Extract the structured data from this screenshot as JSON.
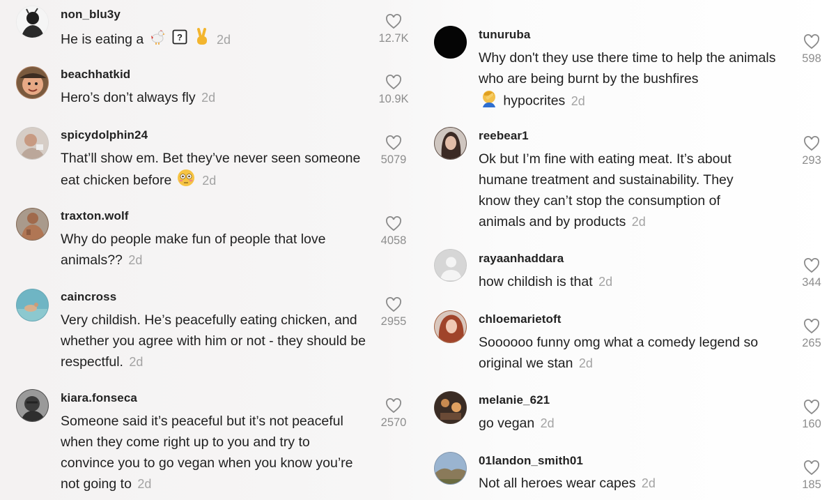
{
  "left_comments": [
    {
      "username": "non_blu3y",
      "text": "He is eating a",
      "date": "2d",
      "likes": "12.7K",
      "emoji": [
        "rooster",
        "unknown-box",
        "victory-hand"
      ]
    },
    {
      "username": "beachhatkid",
      "text": "Hero’s don’t always fly",
      "date": "2d",
      "likes": "10.9K"
    },
    {
      "username": "spicydolphin24",
      "text": "That’ll show em. Bet they’ve never seen someone eat chicken before",
      "date": "2d",
      "likes": "5079",
      "emoji": [
        "flushed-face"
      ]
    },
    {
      "username": "traxton.wolf",
      "text": "Why do people make fun of people that love animals??",
      "date": "2d",
      "likes": "4058"
    },
    {
      "username": "caincross",
      "text": "Very childish. He’s peacefully eating chicken, and whether you agree with him or not - they should be respectful.",
      "date": "2d",
      "likes": "2955"
    },
    {
      "username": "kiara.fonseca",
      "text": "Someone said it’s peaceful but it’s not peaceful when they come right up to you and try to convince you to go vegan when you know you’re not going to",
      "date": "2d",
      "likes": "2570"
    }
  ],
  "right_comments": [
    {
      "username": "tunuruba",
      "text": "Why don't they use there time to help the animals who are being burnt by the bushfires",
      "text2": "hypocrites",
      "date": "2d",
      "likes": "598",
      "emoji": [
        "facepalm"
      ]
    },
    {
      "username": "reebear1",
      "text": "Ok but I’m fine with eating meat. It’s about humane treatment and sustainability. They know they can’t stop the consumption of animals and by products",
      "date": "2d",
      "likes": "293"
    },
    {
      "username": "rayaanhaddara",
      "text": "how childish is that",
      "date": "2d",
      "likes": "344"
    },
    {
      "username": "chloemarietoft",
      "text": "Soooooo funny omg what a comedy legend so original we stan",
      "date": "2d",
      "likes": "265"
    },
    {
      "username": "melanie_621",
      "text": "go vegan",
      "date": "2d",
      "likes": "160"
    },
    {
      "username": "01landon_smith01",
      "text": "Not all heroes wear capes",
      "date": "2d",
      "likes": "185"
    }
  ],
  "icons": {
    "like": "heart-outline-icon",
    "default_avatar": "person-icon"
  },
  "colors": {
    "date": "#a3a3a3",
    "count": "#8d8d8d",
    "username": "#222222",
    "text": "#1f1f1f"
  }
}
